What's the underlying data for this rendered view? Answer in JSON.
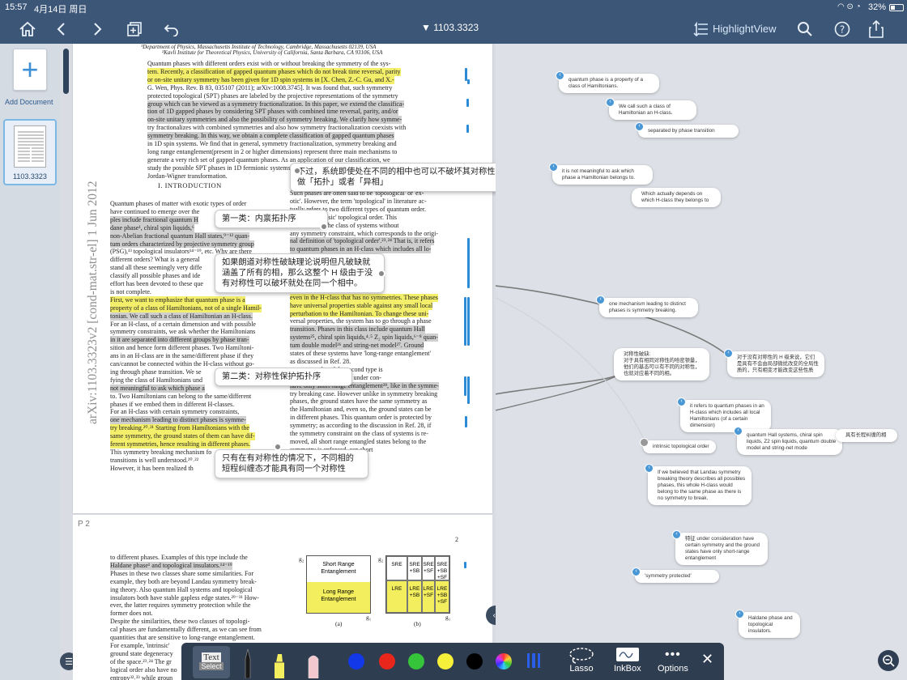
{
  "status": {
    "time": "15:57",
    "date": "4月14日 周日",
    "battery": "32%"
  },
  "header": {
    "doc_title": "▼ 1103.3323",
    "highlight_view_label": "HighlightView"
  },
  "sidebar": {
    "add_document_label": "Add Document",
    "thumb_label": "1103.3323"
  },
  "page1": {
    "affil1": "¹Department of Physics, Massachusetts Institute of Technology, Cambridge, Massachusetts 02139, USA",
    "affil2": "²Kavli Institute for Theoretical Physics, University of California, Santa Barbara, CA 93106, USA",
    "abstract_lines": [
      "Quantum phases with different orders exist with or without breaking the symmetry of the sys-",
      "tem. Recently, a classification of gapped quantum phases which do not break time reversal, parity",
      "or on-site unitary symmetry has been given for 1D spin systems in [X. Chen, Z.-C. Gu, and X.-",
      "G. Wen, Phys. Rev. B 83, 035107 (2011); arXiv:1008.3745]. It was found that, such symmetry",
      "protected topological (SPT) phases are labeled by the projective representations of the symmetry",
      "group which can be viewed as a symmetry fractionalization. In this paper, we extend the classifica-",
      "tion of 1D gapped phases by considering SPT phases with combined time reversal, parity, and/or",
      "on-site unitary symmetries and also the possibility of symmetry breaking. We clarify how symme-",
      "try fractionalizes with combined symmetries and also how symmetry fractionalization coexists with",
      "symmetry breaking. In this way, we obtain a complete classification of gapped quantum phases",
      "in 1D spin systems. We find that in general, symmetry fractionalization, symmetry breaking and",
      "long range entanglement(present in 2 or higher dimensions) represent three main mechanisms to",
      "generate a very rich set of gapped quantum phases. As an application of our classification, we",
      "study the possible SPT phases in 1D fermionic systems, which can be mapped to spin systems by",
      "Jordan-Wigner transformation."
    ],
    "section_heading": "I.   INTRODUCTION",
    "arxiv_stamp": "arXiv:1103.3323v2  [cond-mat.str-el]  1 Jun 2012",
    "left_col": [
      "Quantum phases of matter with exotic types of order",
      "have continued to emerge over the",
      "ples include fractional quantum H",
      "dane phase¹, chiral spin liquids,⁶",
      "non-Abelian fractional quantum Hall states,⁹⁻¹² quan-",
      "tum orders characterized by projective symmetry group",
      "(PSG),¹³ topological insulators¹⁴⁻¹⁹, etc. Why are there",
      "different orders? What is a general",
      "stand all these seemingly very diffe",
      "classify all possible phases and ide",
      "effort has been devoted to these que",
      "is not complete.",
      "First, we want to emphasize that quantum phase is a",
      "property of a class of Hamiltonians, not of a single Hamil-",
      "tonian. We call such a class of Hamiltonian an H-class.",
      "For an H-class, of a certain dimension and with possible",
      "symmetry constraints, we ask whether the Hamiltonians",
      "in it are separated into different groups by phase tran-",
      "sition and hence form different phases. Two Hamiltoni-",
      "ans in an H-class are in the same/different phase if they",
      "can/cannot be connected within the H-class without go-",
      "ing through phase transition. We se",
      "fying the class of Hamiltonians und",
      "not meaningful to ask which phase a",
      "to. Two Hamiltonians can belong to the same/different",
      "phases if we embed them in different H-classes.",
      "For an H-class with certain symmetry constraints,",
      "one mechanism leading to distinct phases is symme-",
      "try breaking.²⁰˒²¹ Starting from Hamiltonians with the",
      "same symmetry, the ground states of them can have dif-",
      "ferent symmetries, hence resulting in different phases.",
      "This symmetry breaking mechanism fo",
      "transitions is well understood.²⁰˒²²",
      "However, it has been realized th"
    ],
    "right_col": [
      "Such phases are often said to be 'topological' or 'ex-",
      "otic'. However, the term 'topological' in literature ac-",
      "tually refers to two different types of quantum order.",
      "type has 'intrinsic' topological order. This",
      "is defined for the class of systems without",
      "any symmetry constraint, which corresponds to the origi-",
      "nal definition of 'topological order'.²³˒²⁴ That is, it refers",
      "to quantum phases in an H-class which includes all lo-",
      "mension). If we believed",
      "theory describes all pos-",
      "would belong to the same",
      "break. However, in the",
      "actually distinct phases",
      "even in the H-class that has no symmetries. These phases",
      "have universal properties stable against any small local",
      "perturbation to the Hamiltonian. To change these uni-",
      "versal properties, the system has to go through a phase",
      "transition. Phases in this class include quantum Hall",
      "systems²⁵, chiral spin liquids,⁴˒⁵ Z₂ spin liquids,⁶⁻⁸ quan-",
      "tum double model²⁶ and string-net model²⁷. Ground",
      "states of these systems have 'long-range entanglement'",
      "as discussed in Ref. 28.",
      "quantum order of the second type is",
      "of. The class of systems under con-",
      "have only short-range entanglement²⁸, like in the symme-",
      "try breaking case. However unlike in symmetry breaking",
      "phases, the ground states have the same symmetry as",
      "the Hamiltonian and, even so, the ground states can be",
      "in different phases. This quantum order is protected by",
      "symmetry; as according to the discussion in Ref. 28, if",
      "the symmetry constraint on the class of systems is re-",
      "moved, all short range entangled states belong to the",
      "symmetry is enforced, can short",
      "which are symmetry belong"
    ]
  },
  "callouts": {
    "c1": "不过，系统即使处在不同的相中也可以不破坏其对称性，这就叫做「拓扑」或者「异相」",
    "c2": "第一类：内禀拓扑序",
    "c3": "如果朗道对称性破缺理论说明但凡破缺就涵盖了所有的相，那么这整个 H 级由于没有对称性可以破坏就处在同一个相中。",
    "c4": "第二类：对称性保护拓扑序",
    "c5": "只有在有对称性的情况下，不同相的短程纠缠态才能具有同一个对称性"
  },
  "page2": {
    "label": "P 2",
    "page_number": "2",
    "lines": [
      "to different phases. Examples of this type include the",
      "Haldane phase¹ and topological insulators.¹⁴⁻¹⁹",
      "Phases in these two classes share some similarities. For",
      "example, they both are beyond Landau symmetry break-",
      "ing theory. Also quantum Hall systems and topological",
      "insulators both have stable gapless edge states.²⁹⁻³¹ How-",
      "ever, the latter requires symmetry protection while the",
      "former does not.",
      "Despite the similarities, these two classes of topologi-",
      "cal phases are fundamentally different, as we can see from",
      "quantities that are sensitive to long-range entanglement.",
      "For example, 'intrinsic'",
      "ground state degeneracy",
      "of the space.²³˒²⁴ The gr",
      "logical order also have no",
      "entropy³²˒³³ while groun"
    ],
    "fig_a_top": "Short Range Entanglement",
    "fig_a_bot": "Long Range Entanglement",
    "fig_a_caption": "(a)",
    "fig_b_caption": "(b)",
    "fig_b_cells": [
      "SRE",
      "SRE +SB",
      "SRE +SF",
      "SRE +SB +SF",
      "LRE",
      "LRE +SB",
      "LRE +SF",
      "LRE +SB +SF"
    ],
    "axis_g": "g₁",
    "axis_g2": "g₂"
  },
  "map_nodes": {
    "n1": "quantum phase is a  property of a class of Hamiltonians.",
    "n2": "We call such a class of Hamiltonian an H-class.",
    "n3": "separated by phase transition",
    "n4": "it is  not meaningful to ask which phase a Hamiltonian belongs  to.",
    "n5": "Which actually depends on which H-class they belongs to",
    "n6": "one mechanism leading to distinct phases is symmetry breaking.",
    "n7": "对称性破缺:\n对于具有相同对称性的哈密顿量，他们的基态可以有不同的对称性，也就对应着不同的相。",
    "n8": "对于没有对称性的 H 级来说，它们是具有不会由局部微扰改变的全局性质的，只有相变才能改变这些性质",
    "n9": "it refers  to quantum phases in an H-class which includes all local Hamiltonians (of a certain dimension)",
    "n10": "intrinsic topological order",
    "n11": "quantum Hall  systems, chiral spin liquids, Z2 spin liquids, quantum double model and string-net mode",
    "n12": "具有长程纠缠的相",
    "n13": "If we believed  that Landau symmetry breaking theory describes all possibles phases, this whole H-class would belong to the same  phase as there is no symmetry to break.",
    "n14": "特征  under consideration have certain symmetry and the ground states  have only short-range entanglement",
    "n15": "'symmetry protected'",
    "n16": "Haldane phase and topological insulators."
  },
  "toolbar": {
    "text_label": "Text",
    "select_label": "Select",
    "lasso_label": "Lasso",
    "inkbox_label": "InkBox",
    "options_label": "Options"
  },
  "colors": {
    "blue": "#1238e8",
    "red": "#e8261c",
    "green": "#36c43b",
    "yellow": "#f6f03a",
    "black": "#000000",
    "accent": "#3c5677"
  }
}
